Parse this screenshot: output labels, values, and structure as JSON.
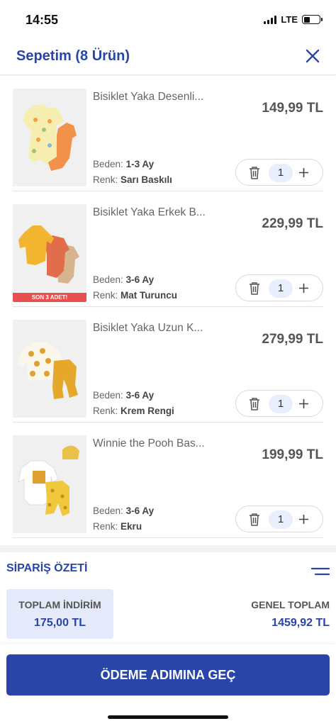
{
  "status_bar": {
    "time": "14:55",
    "network": "LTE"
  },
  "header": {
    "title": "Sepetim (8 Ürün)",
    "close_icon": "close-icon"
  },
  "cart": {
    "size_label": "Beden:",
    "color_label": "Renk:",
    "items": [
      {
        "name": "Bisiklet Yaka Desenli...",
        "price": "149,99 TL",
        "size": "1-3 Ay",
        "color": "Sarı Baskılı",
        "quantity": "1",
        "badge": ""
      },
      {
        "name": "Bisiklet Yaka Erkek B...",
        "price": "229,99 TL",
        "size": "3-6 Ay",
        "color": "Mat Turuncu",
        "quantity": "1",
        "badge": "SON 3 ADET!"
      },
      {
        "name": "Bisiklet Yaka Uzun K...",
        "price": "279,99 TL",
        "size": "3-6 Ay",
        "color": "Krem Rengi",
        "quantity": "1",
        "badge": ""
      },
      {
        "name": "Winnie the Pooh Bas...",
        "price": "199,99 TL",
        "size": "3-6 Ay",
        "color": "Ekru",
        "quantity": "1",
        "badge": ""
      }
    ]
  },
  "summary": {
    "title": "SİPARİŞ ÖZETİ",
    "discount_label": "TOPLAM İNDİRİM",
    "discount_value": "175,00 TL",
    "total_label": "GENEL TOPLAM",
    "total_value": "1459,92 TL"
  },
  "checkout": {
    "button_label": "ÖDEME ADIMINA GEÇ"
  },
  "colors": {
    "brand_blue": "#2945a8",
    "discount_bg": "#e4eaf9",
    "badge_red": "#e8504f"
  }
}
